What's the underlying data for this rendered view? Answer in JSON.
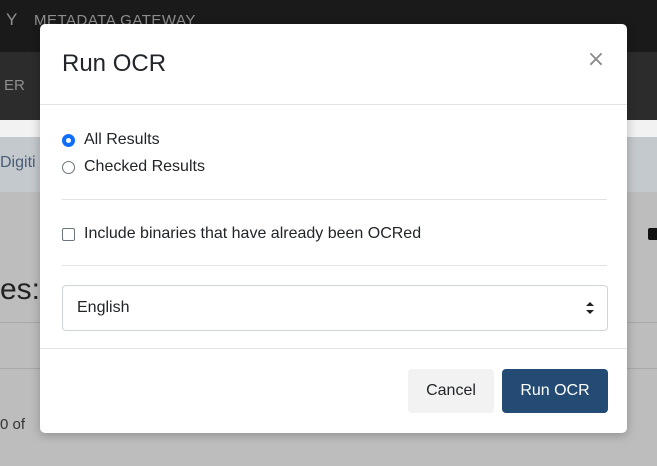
{
  "background": {
    "topbar_icon_glyph": "Y",
    "topbar_title": "METADATA GATEWAY",
    "nav_fragment": "ER",
    "breadcrumb_fragment": "Digiti",
    "heading_fragment": "es:",
    "count_fragment": "0 of"
  },
  "modal": {
    "title": "Run OCR",
    "close_glyph": "×",
    "scope_options": [
      {
        "label": "All Results",
        "selected": true
      },
      {
        "label": "Checked Results",
        "selected": false
      }
    ],
    "include_ocred": {
      "label": "Include binaries that have already been OCRed",
      "checked": false
    },
    "language_select": {
      "value": "English"
    },
    "buttons": {
      "cancel": "Cancel",
      "run": "Run OCR"
    }
  },
  "colors": {
    "primary_button": "#244b74",
    "radio_accent": "#0d6efd"
  }
}
